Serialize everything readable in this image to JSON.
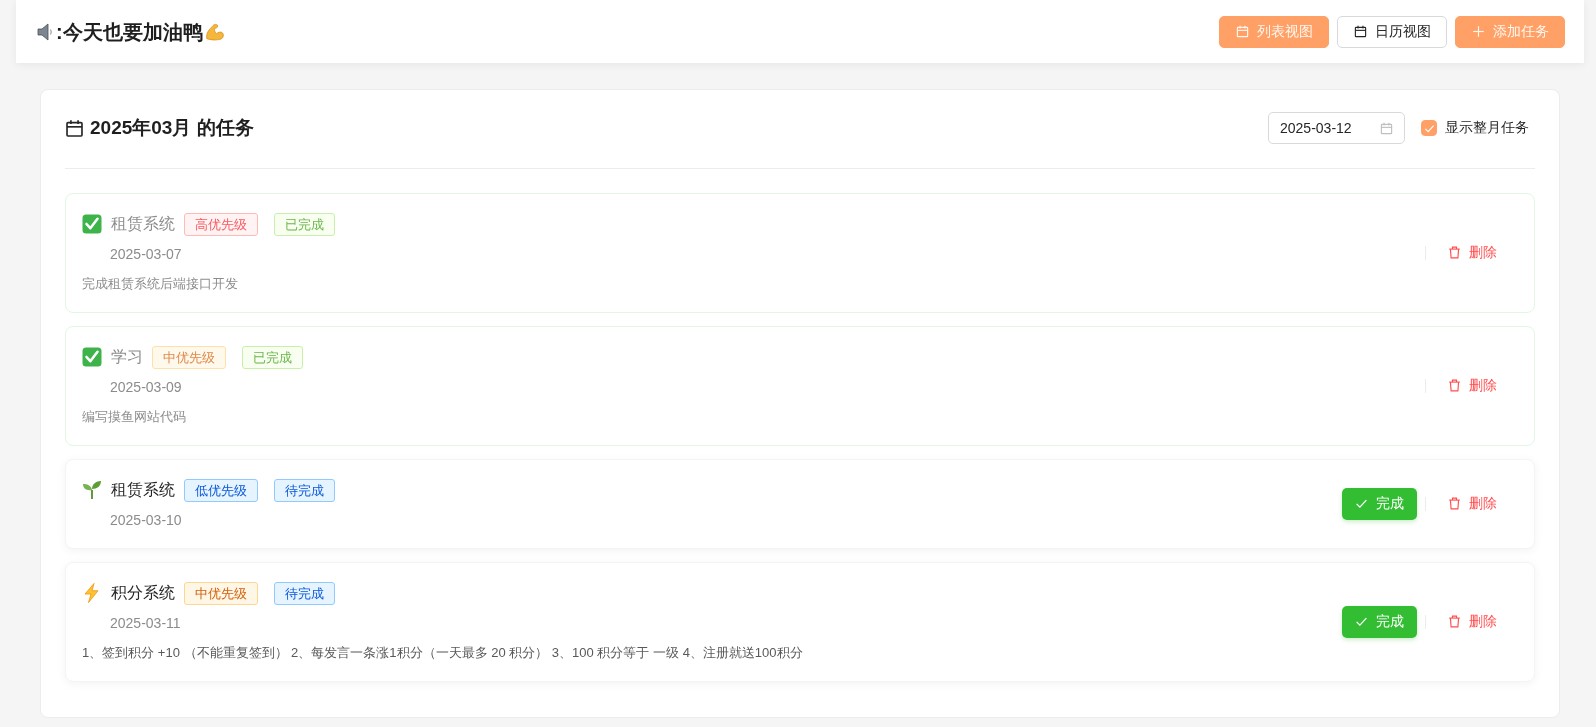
{
  "header": {
    "title": ":今天也要加油鸭",
    "view_buttons": [
      {
        "label": "列表视图",
        "selected": true
      },
      {
        "label": "日历视图",
        "selected": false
      }
    ],
    "add_button": {
      "label": "添加任务"
    }
  },
  "panel": {
    "title": "2025年03月 的任务",
    "date_field": {
      "value": "2025-03-12"
    },
    "month_toggle": {
      "label": "显示整月任务",
      "checked": true
    }
  },
  "tasks": [
    {
      "title": "租赁系统",
      "priority": {
        "kind": "high",
        "label": "高优先级"
      },
      "status": "已完成",
      "completed": true,
      "date": "2025-03-07",
      "description": "完成租赁系统后端接口开发",
      "delete_label": "删除"
    },
    {
      "title": "学习",
      "priority": {
        "kind": "medium",
        "label": "中优先级"
      },
      "status": "已完成",
      "completed": true,
      "date": "2025-03-09",
      "description": "编写摸鱼网站代码",
      "delete_label": "删除"
    },
    {
      "title": "租赁系统",
      "priority": {
        "kind": "low",
        "label": "低优先级"
      },
      "status": "待完成",
      "completed": false,
      "date": "2025-03-10",
      "complete_label": "完成",
      "delete_label": "删除"
    },
    {
      "title": "积分系统",
      "priority": {
        "kind": "medium",
        "label": "中优先级"
      },
      "status": "待完成",
      "completed": false,
      "date": "2025-03-11",
      "description": "1、签到积分 +10 （不能重复签到） 2、每发言一条涨1积分（一天最多 20 积分） 3、100 积分等于 一级 4、注册就送100积分",
      "complete_label": "完成",
      "delete_label": "删除"
    }
  ]
}
